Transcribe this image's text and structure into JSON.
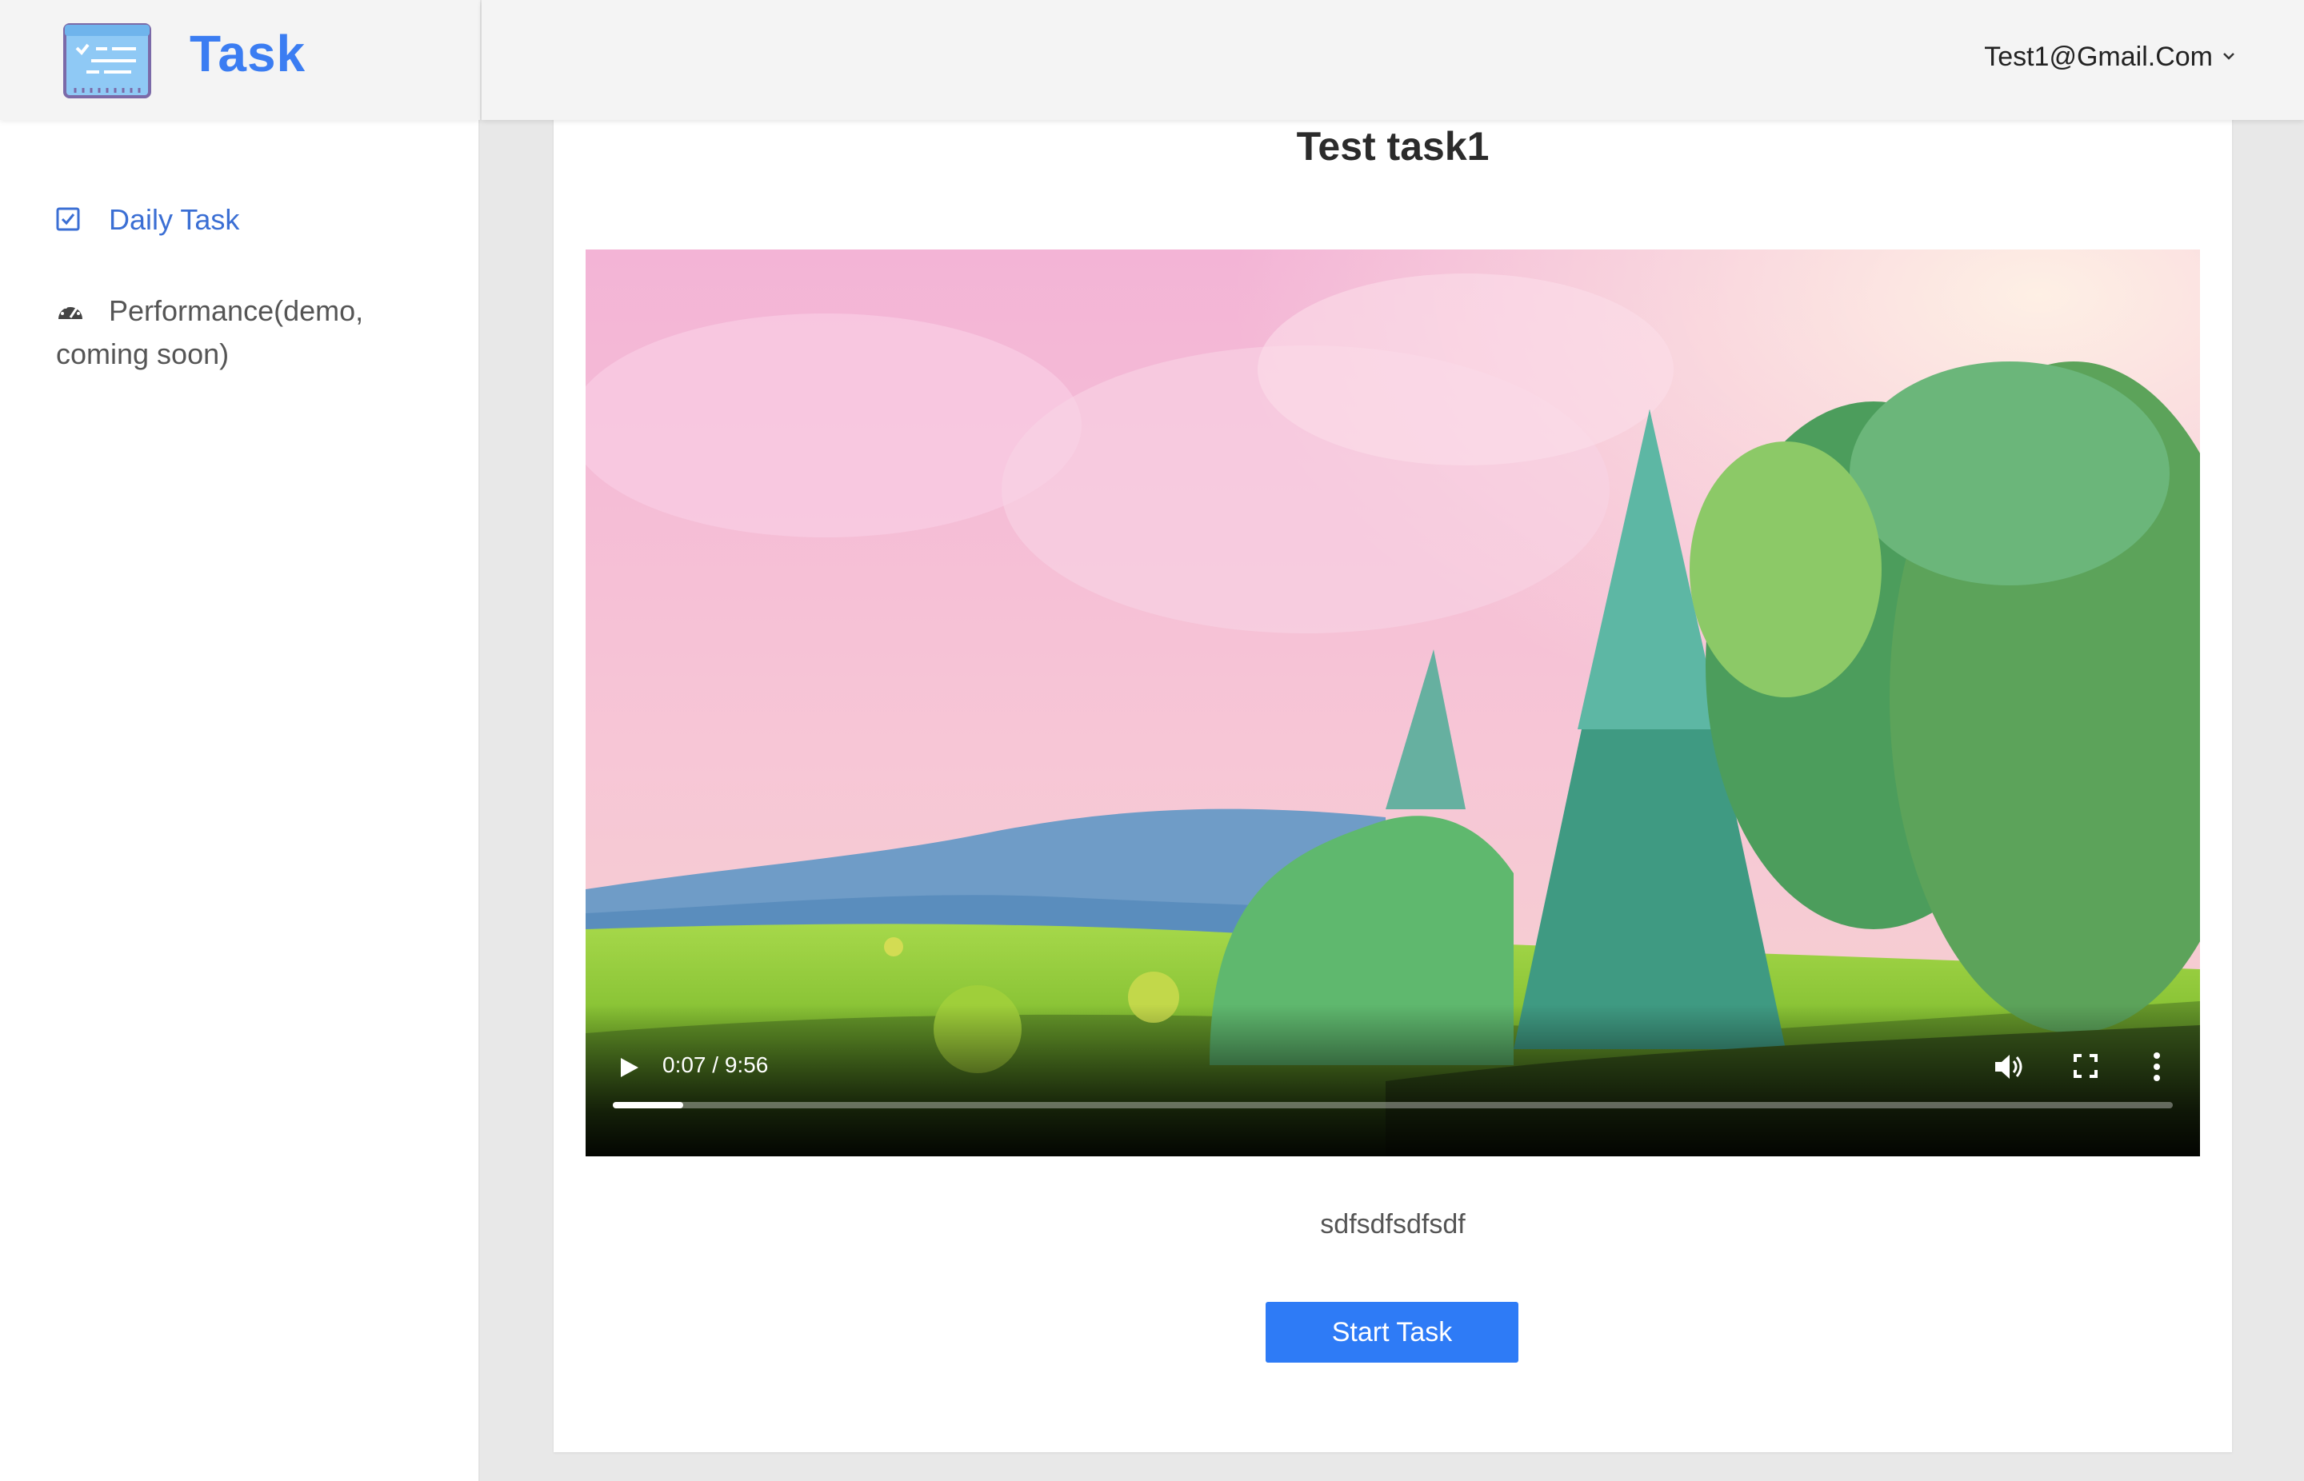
{
  "brand": {
    "title": "Task",
    "logo_icon": "task-list-icon"
  },
  "sidebar": {
    "items": [
      {
        "label": "Daily Task",
        "icon": "checkbox-icon",
        "active": true,
        "color": "#3b6fd4"
      },
      {
        "label": "Performance(demo, coming soon)",
        "icon": "speedometer-icon",
        "active": false
      }
    ]
  },
  "header": {
    "user_email": "Test1@Gmail.Com",
    "dropdown_icon": "chevron-down-icon"
  },
  "task": {
    "title": "Test task1",
    "description": "sdfsdfsdfsdf",
    "start_button_label": "Start Task"
  },
  "video": {
    "time_display": "0:07 / 9:56",
    "progress": 0.045,
    "icons": [
      "play-icon",
      "volume-icon",
      "fullscreen-icon",
      "more-options-icon"
    ]
  },
  "colors": {
    "accent": "#2e7bf6",
    "brand": "#3b7df2"
  }
}
